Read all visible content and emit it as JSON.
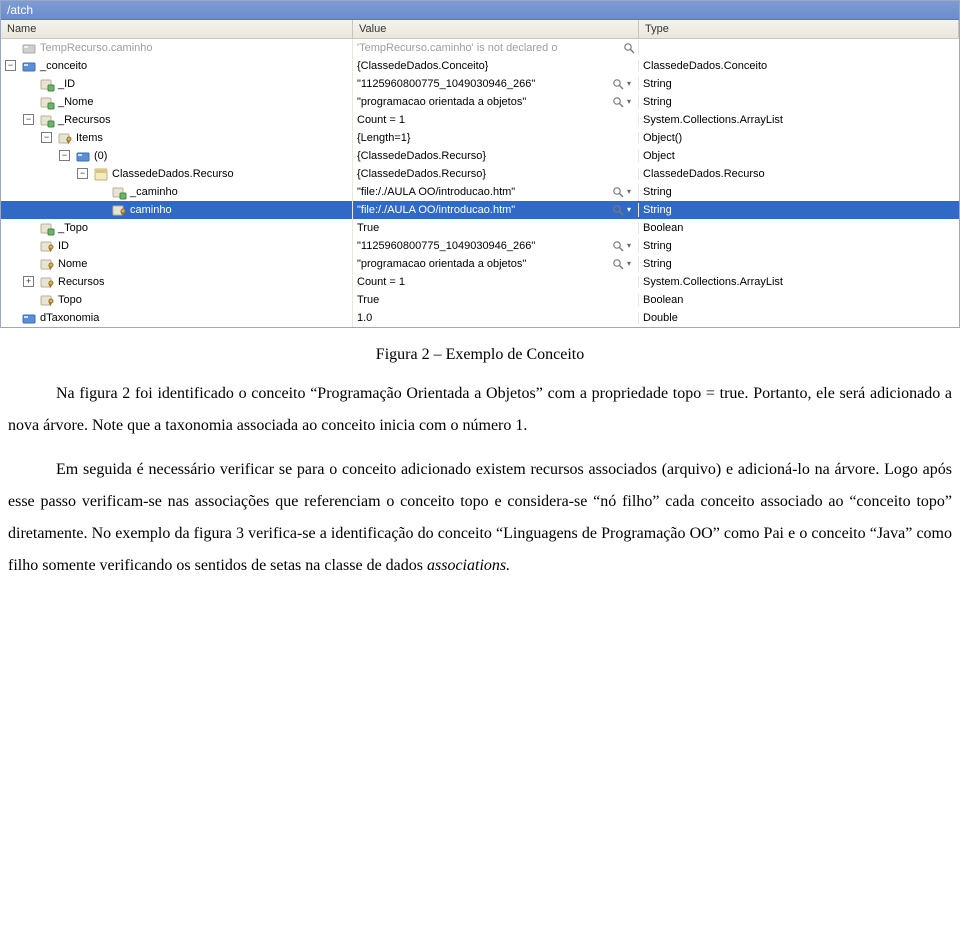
{
  "titlebar": "/atch",
  "columns": {
    "name": "Name",
    "value": "Value",
    "type": "Type"
  },
  "rows": [
    {
      "name": "TempRecurso.caminho",
      "value": "'TempRecurso.caminho' is not declared o",
      "type": "",
      "indent": 0,
      "toggle": "",
      "icon": "var-gray",
      "disabled": true,
      "mag": true,
      "drop": false,
      "selected": false
    },
    {
      "name": "_conceito",
      "value": "{ClassedeDados.Conceito}",
      "type": "ClassedeDados.Conceito",
      "indent": 0,
      "toggle": "-",
      "icon": "var-blue",
      "disabled": false,
      "mag": false,
      "drop": false,
      "selected": false
    },
    {
      "name": "_ID",
      "value": "\"1125960800775_1049030946_266\"",
      "type": "String",
      "indent": 1,
      "toggle": "",
      "icon": "field",
      "disabled": false,
      "mag": true,
      "drop": true,
      "selected": false
    },
    {
      "name": "_Nome",
      "value": "\"programacao orientada a objetos\"",
      "type": "String",
      "indent": 1,
      "toggle": "",
      "icon": "field",
      "disabled": false,
      "mag": true,
      "drop": true,
      "selected": false
    },
    {
      "name": "_Recursos",
      "value": "Count = 1",
      "type": "System.Collections.ArrayList",
      "indent": 1,
      "toggle": "-",
      "icon": "field",
      "disabled": false,
      "mag": false,
      "drop": false,
      "selected": false
    },
    {
      "name": "Items",
      "value": "{Length=1}",
      "type": "Object()",
      "indent": 2,
      "toggle": "-",
      "icon": "prop",
      "disabled": false,
      "mag": false,
      "drop": false,
      "selected": false
    },
    {
      "name": "(0)",
      "value": "{ClassedeDados.Recurso}",
      "type": "Object",
      "indent": 3,
      "toggle": "-",
      "icon": "var-blue",
      "disabled": false,
      "mag": false,
      "drop": false,
      "selected": false
    },
    {
      "name": "ClassedeDados.Recurso",
      "value": "{ClassedeDados.Recurso}",
      "type": "ClassedeDados.Recurso",
      "indent": 4,
      "toggle": "-",
      "icon": "class",
      "disabled": false,
      "mag": false,
      "drop": false,
      "selected": false
    },
    {
      "name": "_caminho",
      "value": "\"file:/./AULA OO/introducao.htm\"",
      "type": "String",
      "indent": 5,
      "toggle": "",
      "icon": "field",
      "disabled": false,
      "mag": true,
      "drop": true,
      "selected": false
    },
    {
      "name": "caminho",
      "value": "\"file:/./AULA OO/introducao.htm\"",
      "type": "String",
      "indent": 5,
      "toggle": "",
      "icon": "prop",
      "disabled": false,
      "mag": true,
      "drop": true,
      "selected": true
    },
    {
      "name": "_Topo",
      "value": "True",
      "type": "Boolean",
      "indent": 1,
      "toggle": "",
      "icon": "field",
      "disabled": false,
      "mag": false,
      "drop": false,
      "selected": false
    },
    {
      "name": "ID",
      "value": "\"1125960800775_1049030946_266\"",
      "type": "String",
      "indent": 1,
      "toggle": "",
      "icon": "prop",
      "disabled": false,
      "mag": true,
      "drop": true,
      "selected": false
    },
    {
      "name": "Nome",
      "value": "\"programacao orientada a objetos\"",
      "type": "String",
      "indent": 1,
      "toggle": "",
      "icon": "prop",
      "disabled": false,
      "mag": true,
      "drop": true,
      "selected": false
    },
    {
      "name": "Recursos",
      "value": "Count = 1",
      "type": "System.Collections.ArrayList",
      "indent": 1,
      "toggle": "+",
      "icon": "prop",
      "disabled": false,
      "mag": false,
      "drop": false,
      "selected": false
    },
    {
      "name": "Topo",
      "value": "True",
      "type": "Boolean",
      "indent": 1,
      "toggle": "",
      "icon": "prop",
      "disabled": false,
      "mag": false,
      "drop": false,
      "selected": false
    },
    {
      "name": "dTaxonomia",
      "value": "1.0",
      "type": "Double",
      "indent": 0,
      "toggle": "",
      "icon": "var-blue",
      "disabled": false,
      "mag": false,
      "drop": false,
      "selected": false
    }
  ],
  "caption": "Figura 2 – Exemplo de Conceito",
  "para1": "Na figura 2 foi identificado o conceito “Programação Orientada a Objetos” com  a propriedade topo = true. Portanto, ele será adicionado a nova árvore. Note que a taxonomia associada ao conceito inicia com o número 1.",
  "para2": "Em seguida é necessário verificar se para o conceito adicionado existem recursos associados (arquivo) e adicioná-lo na árvore. Logo após esse passo verificam-se nas associações que referenciam o conceito topo e considera-se “nó filho” cada conceito associado ao “conceito  topo” diretamente. No exemplo da figura 3 verifica-se a identificação do conceito “Linguagens de Programação OO” como Pai e o conceito “Java” como filho somente verificando os sentidos de setas na classe de dados ",
  "para2_em": "associations."
}
